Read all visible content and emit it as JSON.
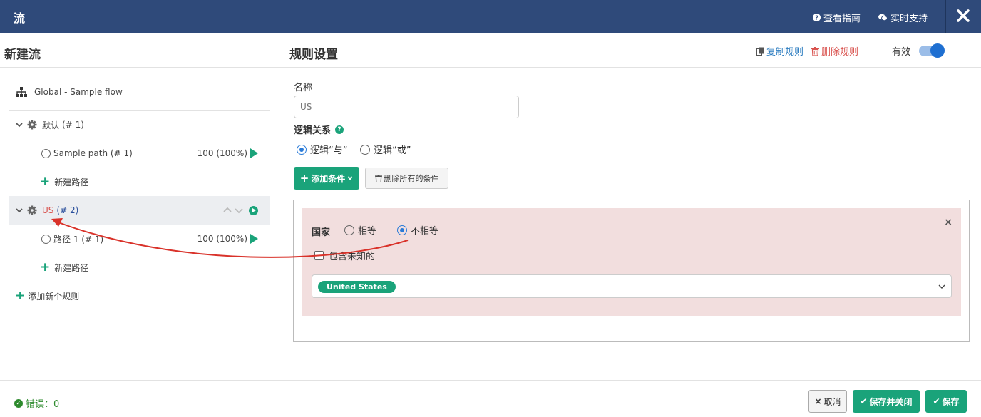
{
  "topbar": {
    "title": "流",
    "guide_label": "查看指南",
    "support_label": "实时支持"
  },
  "left": {
    "header": "新建流",
    "root_label": "Global - Sample flow",
    "rules": [
      {
        "label": "默认",
        "index": "(# 1)",
        "paths": [
          {
            "label": "Sample path (# 1)",
            "pct": "100 (100%)"
          }
        ],
        "new_path": "新建路径"
      },
      {
        "label": "US",
        "index": "(# 2)",
        "paths": [
          {
            "label": "路径 1 (# 1)",
            "pct": "100 (100%)"
          }
        ],
        "new_path": "新建路径"
      }
    ],
    "add_rule": "添加新个规则"
  },
  "right": {
    "header": "规则设置",
    "copy_label": "复制规则",
    "delete_label": "删除规则",
    "valid_label": "有效",
    "name_label": "名称",
    "name_value": "US",
    "logic_label": "逻辑关系",
    "logic_and": "逻辑“与”",
    "logic_or": "逻辑“或”",
    "add_condition": "添加条件",
    "delete_all": "删除所有的条件",
    "condition": {
      "field": "国家",
      "equal": "相等",
      "not_equal": "不相等",
      "include_unknown": "包含未知的",
      "tag": "United States"
    }
  },
  "footer": {
    "errors": "错误：0",
    "cancel": "取消",
    "save_close": "保存并关闭",
    "save": "保存"
  },
  "colors": {
    "topbar": "#2f4a7a",
    "accent": "#1aa37a",
    "danger": "#d9534f",
    "link": "#2a7bbf"
  }
}
